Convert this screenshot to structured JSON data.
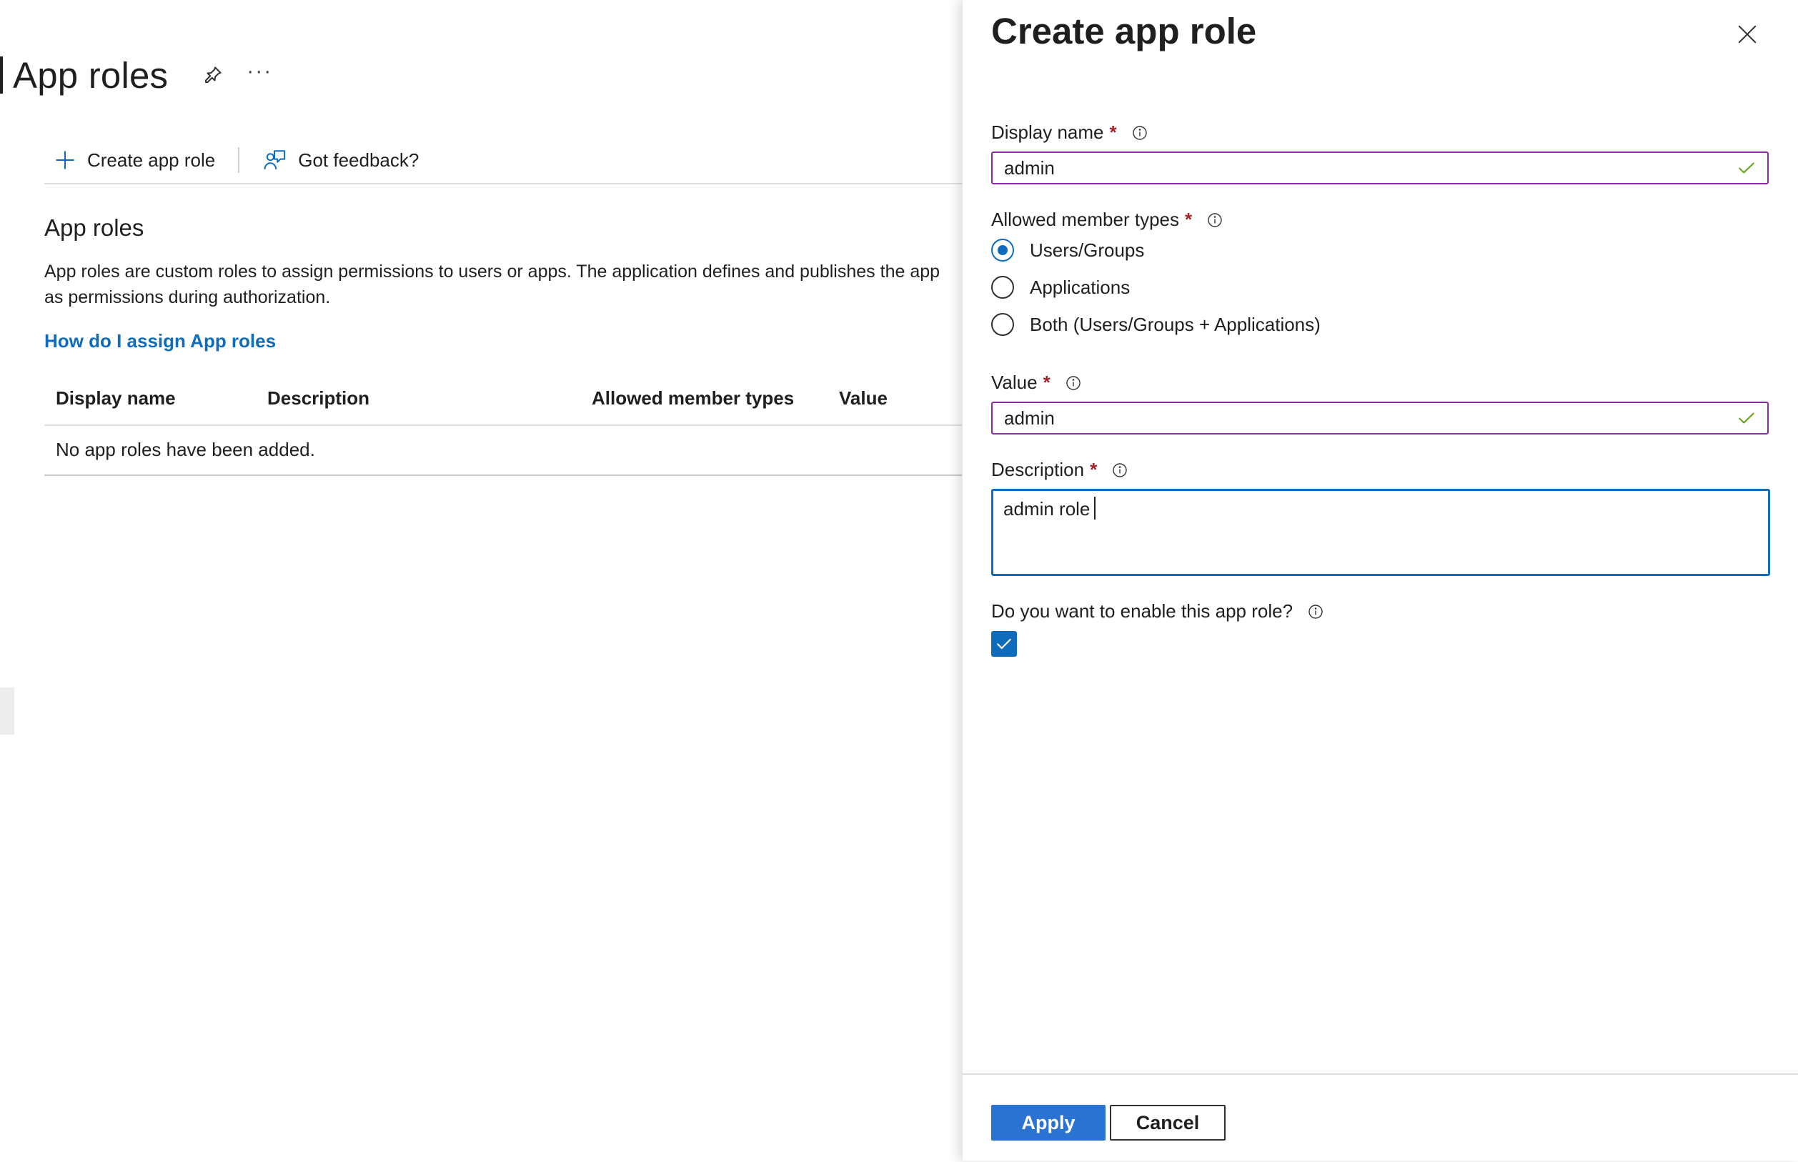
{
  "page": {
    "title": "App roles",
    "more_label": "···",
    "commands": {
      "create_label": "Create app role",
      "feedback_label": "Got feedback?"
    },
    "section": {
      "title": "App roles",
      "description_line1": "App roles are custom roles to assign permissions to users or apps. The application defines and publishes the app",
      "description_line2": "as permissions during authorization.",
      "help_link": "How do I assign App roles"
    },
    "table": {
      "columns": [
        "Display name",
        "Description",
        "Allowed member types",
        "Value"
      ],
      "empty_message": "No app roles have been added."
    }
  },
  "panel": {
    "title": "Create app role",
    "display_name": {
      "label": "Display name",
      "required_mark": "*",
      "value": "admin"
    },
    "member_types": {
      "label": "Allowed member types",
      "required_mark": "*",
      "options": [
        "Users/Groups",
        "Applications",
        "Both (Users/Groups + Applications)"
      ],
      "selected": "Users/Groups"
    },
    "value_field": {
      "label": "Value",
      "required_mark": "*",
      "value": "admin"
    },
    "description": {
      "label": "Description",
      "required_mark": "*",
      "value": "admin role"
    },
    "enable": {
      "label": "Do you want to enable this app role?",
      "checked": true
    },
    "buttons": {
      "apply": "Apply",
      "cancel": "Cancel"
    }
  },
  "colors": {
    "accent_blue": "#0f6cbd",
    "valid_green": "#5ea30b",
    "focus_purple": "#8a2da5",
    "required_red": "#a4262c"
  }
}
